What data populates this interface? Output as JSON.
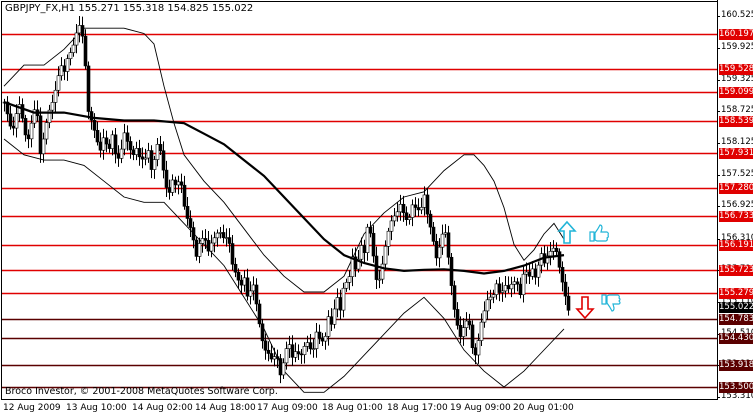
{
  "chart": {
    "title": "GBPJPY_FX,H1  155.271 155.318 154.825 155.022",
    "copyright": "Broco Investor, © 2001-2008 MetaQuotes Software Corp."
  },
  "colors": {
    "background": "#ffffff",
    "level_line": "#e00000",
    "level_line_dark": "#5a0000",
    "candle": "#000000",
    "ma": "#000000",
    "arrow_up": "#22b5d8",
    "arrow_down": "#e00000"
  },
  "icons": {
    "up_arrow": "up-arrow-icon",
    "down_arrow": "down-arrow-icon",
    "hand_up": "thumbs-up-icon",
    "hand_down": "thumbs-down-icon"
  },
  "chart_data": {
    "type": "candlestick",
    "symbol": "GBPJPY_FX",
    "timeframe": "H1",
    "ohlc_header": {
      "open": 155.271,
      "high": 155.318,
      "low": 154.825,
      "close": 155.022
    },
    "current_price": "155.022",
    "ylim": [
      153.31,
      160.55
    ],
    "y_tick_labels": [
      "160.525",
      "159.925",
      "159.325",
      "158.725",
      "158.125",
      "157.525",
      "156.925",
      "156.310",
      "155.710",
      "155.110",
      "154.510",
      "153.910",
      "153.310"
    ],
    "x_tick_labels": [
      "12 Aug 2009",
      "13 Aug 10:00",
      "14 Aug 02:00",
      "14 Aug 18:00",
      "17 Aug 09:00",
      "18 Aug 01:00",
      "18 Aug 17:00",
      "19 Aug 09:00",
      "20 Aug 01:00"
    ],
    "levels": [
      {
        "label": "160.197",
        "value": 160.197,
        "style": "red"
      },
      {
        "label": "159.528",
        "value": 159.528,
        "style": "red"
      },
      {
        "label": "159.099",
        "value": 159.099,
        "style": "red"
      },
      {
        "label": "158.539",
        "value": 158.539,
        "style": "red"
      },
      {
        "label": "157.931",
        "value": 157.931,
        "style": "red"
      },
      {
        "label": "157.280",
        "value": 157.28,
        "style": "red"
      },
      {
        "label": "156.733",
        "value": 156.733,
        "style": "red"
      },
      {
        "label": "156.191",
        "value": 156.191,
        "style": "red"
      },
      {
        "label": "155.723",
        "value": 155.723,
        "style": "red"
      },
      {
        "label": "155.279",
        "value": 155.279,
        "style": "red"
      },
      {
        "label": "154.783",
        "value": 154.783,
        "style": "dark"
      },
      {
        "label": "154.430",
        "value": 154.43,
        "style": "dark"
      },
      {
        "label": "153.918",
        "value": 153.918,
        "style": "dark"
      },
      {
        "label": "153.500",
        "value": 153.5,
        "style": "dark"
      }
    ],
    "close_path": [
      [
        0,
        158.9
      ],
      [
        4,
        158.7
      ],
      [
        8,
        158.3
      ],
      [
        12,
        158.6
      ],
      [
        16,
        158.9
      ],
      [
        20,
        158.4
      ],
      [
        24,
        158.2
      ],
      [
        28,
        158.5
      ],
      [
        32,
        158.9
      ],
      [
        36,
        158.0
      ],
      [
        40,
        158.3
      ],
      [
        44,
        158.6
      ],
      [
        48,
        158.9
      ],
      [
        52,
        159.3
      ],
      [
        56,
        159.6
      ],
      [
        60,
        159.4
      ],
      [
        64,
        159.8
      ],
      [
        68,
        160.0
      ],
      [
        72,
        160.2
      ],
      [
        76,
        160.3
      ],
      [
        80,
        159.9
      ],
      [
        84,
        158.8
      ],
      [
        88,
        158.5
      ],
      [
        92,
        158.1
      ],
      [
        96,
        158.0
      ],
      [
        100,
        158.4
      ],
      [
        104,
        157.9
      ],
      [
        108,
        158.2
      ],
      [
        112,
        157.8
      ],
      [
        116,
        158.0
      ],
      [
        120,
        158.3
      ],
      [
        124,
        158.0
      ],
      [
        128,
        157.9
      ],
      [
        132,
        158.1
      ],
      [
        136,
        157.8
      ],
      [
        140,
        157.7
      ],
      [
        144,
        158.0
      ],
      [
        148,
        157.6
      ],
      [
        152,
        158.1
      ],
      [
        156,
        157.9
      ],
      [
        160,
        157.5
      ],
      [
        164,
        157.2
      ],
      [
        168,
        157.4
      ],
      [
        172,
        157.2
      ],
      [
        176,
        157.5
      ],
      [
        180,
        157.0
      ],
      [
        184,
        156.6
      ],
      [
        188,
        156.3
      ],
      [
        192,
        156.0
      ],
      [
        196,
        156.4
      ],
      [
        200,
        156.3
      ],
      [
        204,
        156.0
      ],
      [
        208,
        156.3
      ],
      [
        212,
        156.5
      ],
      [
        216,
        156.4
      ],
      [
        220,
        156.2
      ],
      [
        224,
        156.4
      ],
      [
        228,
        155.9
      ],
      [
        232,
        155.6
      ],
      [
        236,
        155.3
      ],
      [
        240,
        155.6
      ],
      [
        244,
        155.2
      ],
      [
        248,
        155.5
      ],
      [
        252,
        155.0
      ],
      [
        256,
        154.6
      ],
      [
        260,
        154.3
      ],
      [
        264,
        154.1
      ],
      [
        268,
        153.9
      ],
      [
        272,
        154.2
      ],
      [
        276,
        153.8
      ],
      [
        280,
        154.0
      ],
      [
        284,
        154.3
      ],
      [
        288,
        154.1
      ],
      [
        292,
        154.3
      ],
      [
        296,
        154.0
      ],
      [
        300,
        154.2
      ],
      [
        304,
        154.4
      ],
      [
        308,
        154.2
      ],
      [
        312,
        154.5
      ],
      [
        316,
        154.3
      ],
      [
        320,
        154.4
      ],
      [
        324,
        154.9
      ],
      [
        328,
        154.6
      ],
      [
        332,
        155.2
      ],
      [
        336,
        155.0
      ],
      [
        340,
        155.6
      ],
      [
        344,
        155.4
      ],
      [
        348,
        155.9
      ],
      [
        352,
        155.7
      ],
      [
        356,
        156.3
      ],
      [
        360,
        156.0
      ],
      [
        364,
        156.6
      ],
      [
        368,
        156.2
      ],
      [
        372,
        155.6
      ],
      [
        376,
        155.5
      ],
      [
        380,
        156.0
      ],
      [
        384,
        156.5
      ],
      [
        388,
        156.8
      ],
      [
        392,
        156.7
      ],
      [
        396,
        156.9
      ],
      [
        400,
        156.8
      ],
      [
        404,
        156.7
      ],
      [
        408,
        156.9
      ],
      [
        412,
        156.8
      ],
      [
        416,
        156.9
      ],
      [
        420,
        157.2
      ],
      [
        424,
        156.6
      ],
      [
        428,
        156.3
      ],
      [
        432,
        156.0
      ],
      [
        436,
        156.3
      ],
      [
        440,
        156.5
      ],
      [
        444,
        155.9
      ],
      [
        448,
        155.3
      ],
      [
        452,
        154.8
      ],
      [
        456,
        154.4
      ],
      [
        460,
        154.6
      ],
      [
        464,
        154.9
      ],
      [
        468,
        154.3
      ],
      [
        472,
        154.0
      ],
      [
        476,
        154.6
      ],
      [
        480,
        155.0
      ],
      [
        484,
        155.3
      ],
      [
        488,
        155.1
      ],
      [
        492,
        155.4
      ],
      [
        496,
        155.3
      ],
      [
        500,
        155.5
      ],
      [
        504,
        155.3
      ],
      [
        508,
        155.4
      ],
      [
        512,
        155.6
      ],
      [
        516,
        155.3
      ],
      [
        520,
        155.7
      ],
      [
        524,
        155.5
      ],
      [
        528,
        155.8
      ],
      [
        532,
        155.6
      ],
      [
        536,
        156.0
      ],
      [
        540,
        155.8
      ],
      [
        544,
        156.1
      ],
      [
        548,
        156.2
      ],
      [
        552,
        156.0
      ],
      [
        556,
        155.6
      ],
      [
        560,
        155.4
      ],
      [
        564,
        155.0
      ]
    ],
    "ma_path": [
      [
        0,
        158.9
      ],
      [
        30,
        158.7
      ],
      [
        60,
        158.7
      ],
      [
        90,
        158.6
      ],
      [
        120,
        158.55
      ],
      [
        150,
        158.55
      ],
      [
        180,
        158.5
      ],
      [
        200,
        158.3
      ],
      [
        220,
        158.1
      ],
      [
        240,
        157.8
      ],
      [
        260,
        157.5
      ],
      [
        280,
        157.1
      ],
      [
        300,
        156.7
      ],
      [
        320,
        156.3
      ],
      [
        340,
        156.0
      ],
      [
        360,
        155.85
      ],
      [
        380,
        155.75
      ],
      [
        400,
        155.7
      ],
      [
        420,
        155.72
      ],
      [
        440,
        155.73
      ],
      [
        460,
        155.7
      ],
      [
        480,
        155.65
      ],
      [
        500,
        155.7
      ],
      [
        520,
        155.8
      ],
      [
        540,
        155.95
      ],
      [
        560,
        156.0
      ]
    ],
    "band_upper_path": [
      [
        0,
        159.2
      ],
      [
        20,
        159.6
      ],
      [
        40,
        159.6
      ],
      [
        60,
        159.9
      ],
      [
        80,
        160.3
      ],
      [
        100,
        160.3
      ],
      [
        120,
        160.3
      ],
      [
        140,
        160.2
      ],
      [
        150,
        160.0
      ],
      [
        160,
        159.2
      ],
      [
        170,
        158.5
      ],
      [
        180,
        157.9
      ],
      [
        200,
        157.4
      ],
      [
        220,
        157.0
      ],
      [
        240,
        156.5
      ],
      [
        260,
        156.0
      ],
      [
        280,
        155.6
      ],
      [
        300,
        155.3
      ],
      [
        320,
        155.3
      ],
      [
        340,
        155.6
      ],
      [
        360,
        156.4
      ],
      [
        380,
        156.8
      ],
      [
        400,
        157.1
      ],
      [
        420,
        157.2
      ],
      [
        440,
        157.6
      ],
      [
        460,
        157.9
      ],
      [
        470,
        157.9
      ],
      [
        480,
        157.7
      ],
      [
        490,
        157.4
      ],
      [
        500,
        156.9
      ],
      [
        510,
        156.2
      ],
      [
        520,
        155.9
      ],
      [
        530,
        156.1
      ],
      [
        540,
        156.4
      ],
      [
        550,
        156.6
      ],
      [
        560,
        156.3
      ]
    ],
    "band_lower_path": [
      [
        0,
        158.2
      ],
      [
        20,
        157.9
      ],
      [
        40,
        157.8
      ],
      [
        60,
        157.8
      ],
      [
        80,
        157.7
      ],
      [
        100,
        157.4
      ],
      [
        120,
        157.1
      ],
      [
        140,
        157.0
      ],
      [
        160,
        157.0
      ],
      [
        180,
        156.6
      ],
      [
        200,
        156.2
      ],
      [
        220,
        155.8
      ],
      [
        240,
        155.2
      ],
      [
        260,
        154.6
      ],
      [
        280,
        153.8
      ],
      [
        300,
        153.4
      ],
      [
        320,
        153.4
      ],
      [
        340,
        153.7
      ],
      [
        360,
        154.1
      ],
      [
        380,
        154.5
      ],
      [
        400,
        154.9
      ],
      [
        420,
        155.2
      ],
      [
        440,
        154.8
      ],
      [
        460,
        154.2
      ],
      [
        480,
        153.8
      ],
      [
        500,
        153.5
      ],
      [
        520,
        153.8
      ],
      [
        540,
        154.2
      ],
      [
        560,
        154.6
      ]
    ]
  }
}
